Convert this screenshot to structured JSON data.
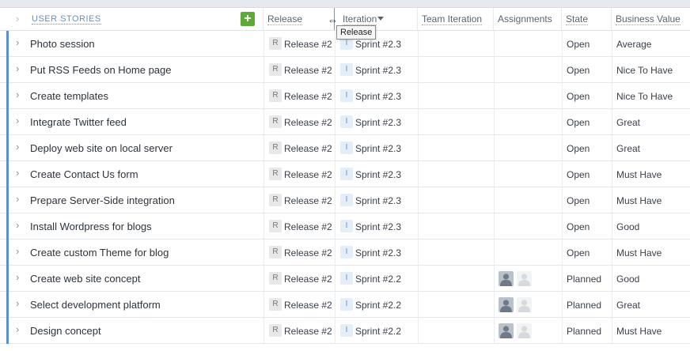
{
  "header": {
    "title": "USER STORIES",
    "add_label": "+",
    "columns": [
      "Release",
      "Iteration",
      "Team Iteration",
      "Assignments",
      "State",
      "Business Value"
    ],
    "tooltip": "Release"
  },
  "colors": {
    "accent_bar": "#5b8fd0",
    "add_button": "#5fa83a"
  },
  "rows": [
    {
      "title": "Photo session",
      "release_tag": "R",
      "release": "Release #2",
      "iteration_tag": "I",
      "iteration": "Sprint #2.3",
      "assignments": 0,
      "state": "Open",
      "business_value": "Average"
    },
    {
      "title": "Put RSS Feeds on Home page",
      "release_tag": "R",
      "release": "Release #2",
      "iteration_tag": "I",
      "iteration": "Sprint #2.3",
      "assignments": 0,
      "state": "Open",
      "business_value": "Nice To Have"
    },
    {
      "title": "Create templates",
      "release_tag": "R",
      "release": "Release #2",
      "iteration_tag": "I",
      "iteration": "Sprint #2.3",
      "assignments": 0,
      "state": "Open",
      "business_value": "Nice To Have"
    },
    {
      "title": "Integrate Twitter feed",
      "release_tag": "R",
      "release": "Release #2",
      "iteration_tag": "I",
      "iteration": "Sprint #2.3",
      "assignments": 0,
      "state": "Open",
      "business_value": "Great"
    },
    {
      "title": "Deploy web site on local server",
      "release_tag": "R",
      "release": "Release #2",
      "iteration_tag": "I",
      "iteration": "Sprint #2.3",
      "assignments": 0,
      "state": "Open",
      "business_value": "Great"
    },
    {
      "title": "Create Contact Us form",
      "release_tag": "R",
      "release": "Release #2",
      "iteration_tag": "I",
      "iteration": "Sprint #2.3",
      "assignments": 0,
      "state": "Open",
      "business_value": "Must Have"
    },
    {
      "title": "Prepare Server-Side integration",
      "release_tag": "R",
      "release": "Release #2",
      "iteration_tag": "I",
      "iteration": "Sprint #2.3",
      "assignments": 0,
      "state": "Open",
      "business_value": "Must Have"
    },
    {
      "title": "Install Wordpress for blogs",
      "release_tag": "R",
      "release": "Release #2",
      "iteration_tag": "I",
      "iteration": "Sprint #2.3",
      "assignments": 0,
      "state": "Open",
      "business_value": "Good"
    },
    {
      "title": "Create custom Theme for blog",
      "release_tag": "R",
      "release": "Release #2",
      "iteration_tag": "I",
      "iteration": "Sprint #2.3",
      "assignments": 0,
      "state": "Open",
      "business_value": "Must Have"
    },
    {
      "title": "Create web site concept",
      "release_tag": "R",
      "release": "Release #2",
      "iteration_tag": "I",
      "iteration": "Sprint #2.2",
      "assignments": 2,
      "state": "Planned",
      "business_value": "Good"
    },
    {
      "title": "Select development platform",
      "release_tag": "R",
      "release": "Release #2",
      "iteration_tag": "I",
      "iteration": "Sprint #2.2",
      "assignments": 2,
      "state": "Planned",
      "business_value": "Great"
    },
    {
      "title": "Design concept",
      "release_tag": "R",
      "release": "Release #2",
      "iteration_tag": "I",
      "iteration": "Sprint #2.2",
      "assignments": 2,
      "state": "Planned",
      "business_value": "Must Have"
    }
  ]
}
